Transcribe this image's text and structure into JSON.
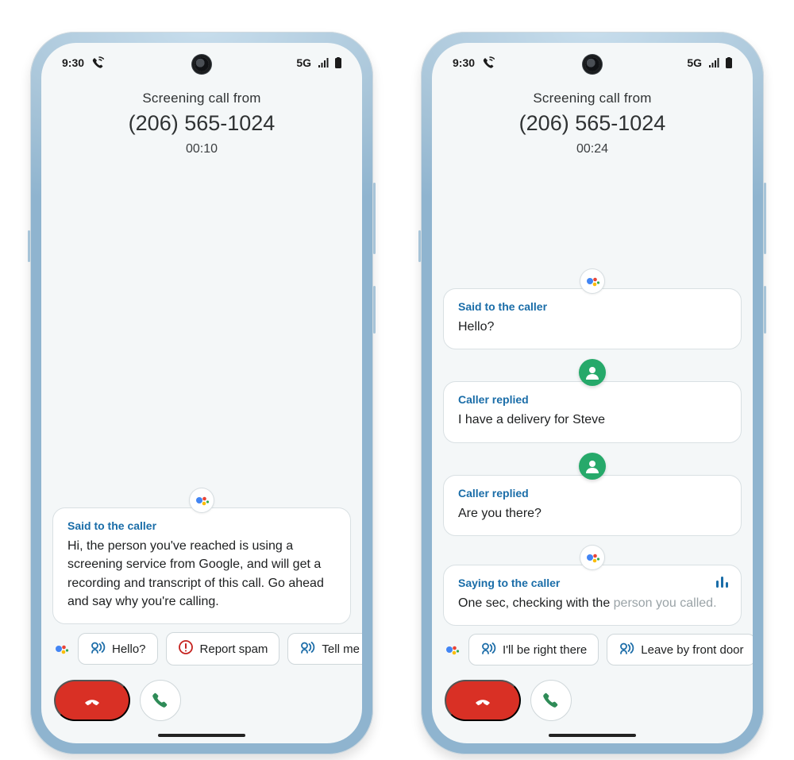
{
  "status": {
    "time": "9:30",
    "network": "5G"
  },
  "phones": [
    {
      "header": {
        "title": "Screening call from",
        "number": "(206) 565-1024",
        "timer": "00:10"
      },
      "cards": [
        {
          "avatar": "assistant",
          "title": "Said to the caller",
          "text": "Hi, the person you've reached is using a screening service from Google, and will get a recording and transcript of this call. Go ahead and say why you're calling.",
          "dim_text": "",
          "speaking": false
        }
      ],
      "chips": [
        {
          "icon": "voice",
          "label": "Hello?"
        },
        {
          "icon": "alert",
          "label": "Report spam"
        },
        {
          "icon": "voice",
          "label": "Tell me mo"
        }
      ]
    },
    {
      "header": {
        "title": "Screening call from",
        "number": "(206) 565-1024",
        "timer": "00:24"
      },
      "cards": [
        {
          "avatar": "assistant",
          "title": "Said to the caller",
          "text": "Hello?",
          "dim_text": "",
          "speaking": false
        },
        {
          "avatar": "caller",
          "title": "Caller replied",
          "text": "I have a delivery for Steve",
          "dim_text": "",
          "speaking": false
        },
        {
          "avatar": "caller",
          "title": "Caller replied",
          "text": "Are you there?",
          "dim_text": "",
          "speaking": false
        },
        {
          "avatar": "assistant",
          "title": "Saying to the caller",
          "text": "One sec, checking with the ",
          "dim_text": "person you called.",
          "speaking": true
        }
      ],
      "chips": [
        {
          "icon": "voice",
          "label": "I'll be right there"
        },
        {
          "icon": "voice",
          "label": "Leave by front door"
        }
      ]
    }
  ]
}
